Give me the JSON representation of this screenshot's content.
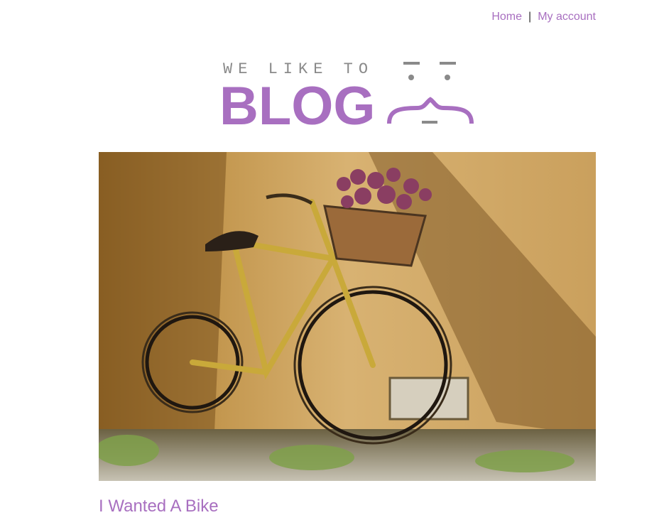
{
  "nav": {
    "home_label": "Home",
    "separator": "|",
    "account_label": "My account"
  },
  "logo": {
    "tagline": "WE LIKE TO",
    "wordmark": "BLOG",
    "brand_color": "#a86fc0",
    "face_color": "#8a8a8a"
  },
  "hero": {
    "subject": "bicycle-photo"
  },
  "post": {
    "title": "I Wanted A Bike"
  }
}
